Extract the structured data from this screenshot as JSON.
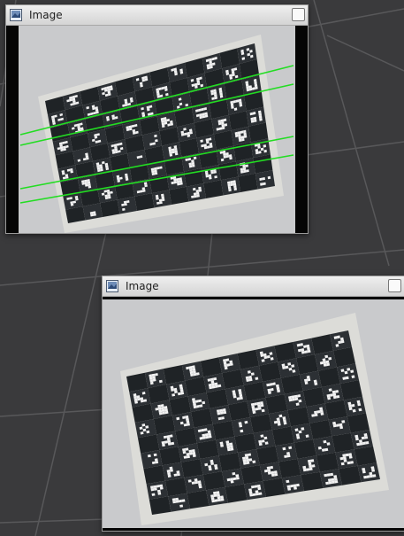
{
  "windows": [
    {
      "id": "win1",
      "title": "Image",
      "icon": "image-window-icon",
      "button": "close-button",
      "overlay_lines": true
    },
    {
      "id": "win2",
      "title": "Image",
      "icon": "image-window-icon",
      "button": "close-button",
      "overlay_lines": false
    }
  ],
  "board": {
    "columns": 12,
    "rows": 9,
    "dark": "#1f2326",
    "light": "#e8e8e4",
    "tag": "#f2f2f2"
  },
  "colors": {
    "backdrop": "#3a3a3c",
    "grid_line": "#5a5a5c",
    "paper": "#dcdcd8",
    "wall": "#c9cacc",
    "detection_line": "#22dd22"
  }
}
